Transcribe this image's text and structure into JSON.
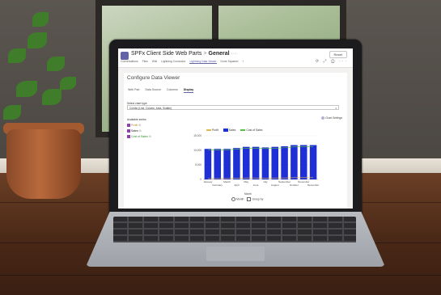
{
  "topbar": {
    "site": "SPFx Client Side Web Parts",
    "channel": "General",
    "more": "···",
    "reset_label": "Reset",
    "tabs": [
      "Conversations",
      "Files",
      "Wiki",
      "Lightning Conductor",
      "Lightning Data Viewer",
      "Done Squared",
      "+"
    ],
    "icons": [
      "refresh-icon",
      "expand-icon",
      "info-icon",
      "more-icon"
    ],
    "icon_glyphs": "⟳ ⤢ ⓘ ···"
  },
  "panel": {
    "title": "Configure Data Viewer",
    "tabs": [
      "Web Part",
      "Data Source",
      "Columns",
      "Display"
    ],
    "active_tab": "Display",
    "chart_type_label": "Select chart type",
    "chart_type_value": "Combo (Line, Column, Area, Scatter)",
    "available_series_label": "Available series",
    "chart_settings_label": "Chart Settings",
    "series": [
      "Profit",
      "Sales",
      "Cost of Sales"
    ]
  },
  "legend": {
    "items": [
      "Profit",
      "Sales",
      "Cost of Sales"
    ]
  },
  "options": {
    "radio_label": "Month",
    "checkbox_label": "Group by"
  },
  "colors": {
    "accent": "#6264a7",
    "sales": "#1f2fd6",
    "profit": "#e0b84a",
    "cost": "#57c13f"
  },
  "chart_data": {
    "type": "bar",
    "xlabel": "Month",
    "ylabel": "",
    "ylim": [
      0,
      15000
    ],
    "y_ticks": [
      "15,000",
      "10,000",
      "5,000",
      "0"
    ],
    "categories": [
      "January",
      "February",
      "March",
      "April",
      "May",
      "June",
      "July",
      "August",
      "September",
      "October",
      "November",
      "December"
    ],
    "series": [
      {
        "name": "Sales",
        "type": "bar",
        "values": [
          10500,
          10500,
          10500,
          10800,
          11200,
          11200,
          11000,
          11200,
          11400,
          11800,
          11800,
          11800
        ]
      },
      {
        "name": "Cost of Sales",
        "type": "line",
        "values": [
          10200,
          10200,
          10200,
          10400,
          10700,
          10700,
          10600,
          10700,
          10900,
          11200,
          11200,
          11200
        ]
      },
      {
        "name": "Profit",
        "type": "line",
        "values": [
          300,
          300,
          300,
          400,
          500,
          500,
          400,
          500,
          500,
          600,
          600,
          600
        ]
      }
    ]
  }
}
